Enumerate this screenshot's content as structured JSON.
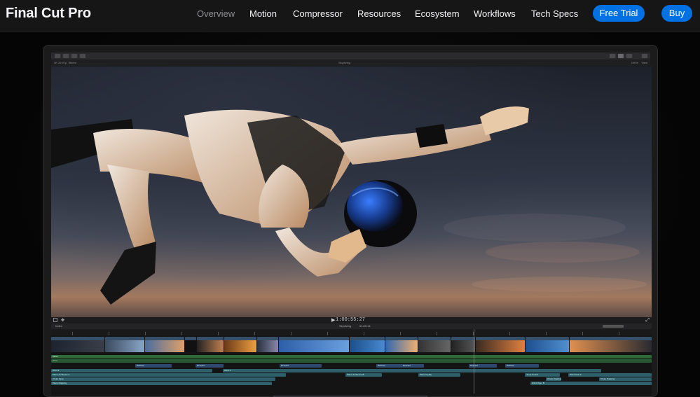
{
  "nav": {
    "brand": "Final Cut Pro",
    "links": [
      "Overview",
      "Motion",
      "Compressor",
      "Resources",
      "Ecosystem",
      "Workflows",
      "Tech Specs"
    ],
    "active_link": "Overview",
    "free_trial_label": "Free Trial",
    "buy_label": "Buy",
    "accent_color": "#0071e3"
  },
  "app": {
    "format_label": "4K 29.97p, Stereo",
    "project_title": "Skydiving",
    "zoom_label": "100%",
    "view_label": "View",
    "timecode": "1:00:55:27",
    "index_label": "Index",
    "timeline_project": "Skydiving",
    "timeline_duration": "01:00:14"
  },
  "timeline": {
    "clip_labels": [
      "Opening Jet",
      "Clubbed Slack",
      "Jetliner",
      "",
      "Van Driver",
      "Swimmer",
      "Speed Flight",
      "",
      "Jumping",
      "Belly over Sunset",
      "Free Fall",
      "Dancing Sky",
      "Spindown",
      "Final Approach",
      "Landing in Sunset"
    ],
    "audio_labels": [
      "Music",
      "Wind",
      "Descent",
      "Descent",
      "Descent",
      "Descent",
      "Descent",
      "Descent",
      "Descent",
      "Wind 1",
      "Wind 2",
      "Plane Ambience A",
      "Plane Ambience B",
      "Plane Fly-By",
      "Jump Sound",
      "Wind Gust 2",
      "Chute Open",
      "Chute Flapping 2",
      "Chute Flapping",
      "Plane Flapping",
      "Wind Open B"
    ]
  }
}
